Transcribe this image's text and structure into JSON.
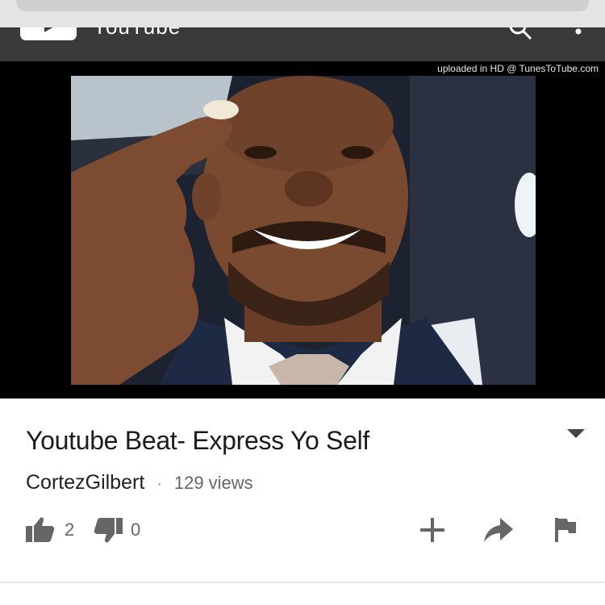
{
  "header": {
    "app_title": "YouTube",
    "icons": [
      "youtube-logo-icon",
      "search-icon",
      "more-vert-icon"
    ]
  },
  "video": {
    "watermark": "uploaded in HD @ TunesToTube.com"
  },
  "info": {
    "title": "Youtube Beat- Express Yo Self",
    "channel": "CortezGilbert",
    "separator": "·",
    "views": "129 views",
    "likes": "2",
    "dislikes": "0",
    "icons": [
      "expand-caret-icon",
      "thumbs-up-icon",
      "thumbs-down-icon",
      "add-icon",
      "share-icon",
      "flag-icon"
    ]
  },
  "colors": {
    "header_bg": "#3a3a3a",
    "video_bg": "#000000",
    "icon_gray": "#666666"
  }
}
